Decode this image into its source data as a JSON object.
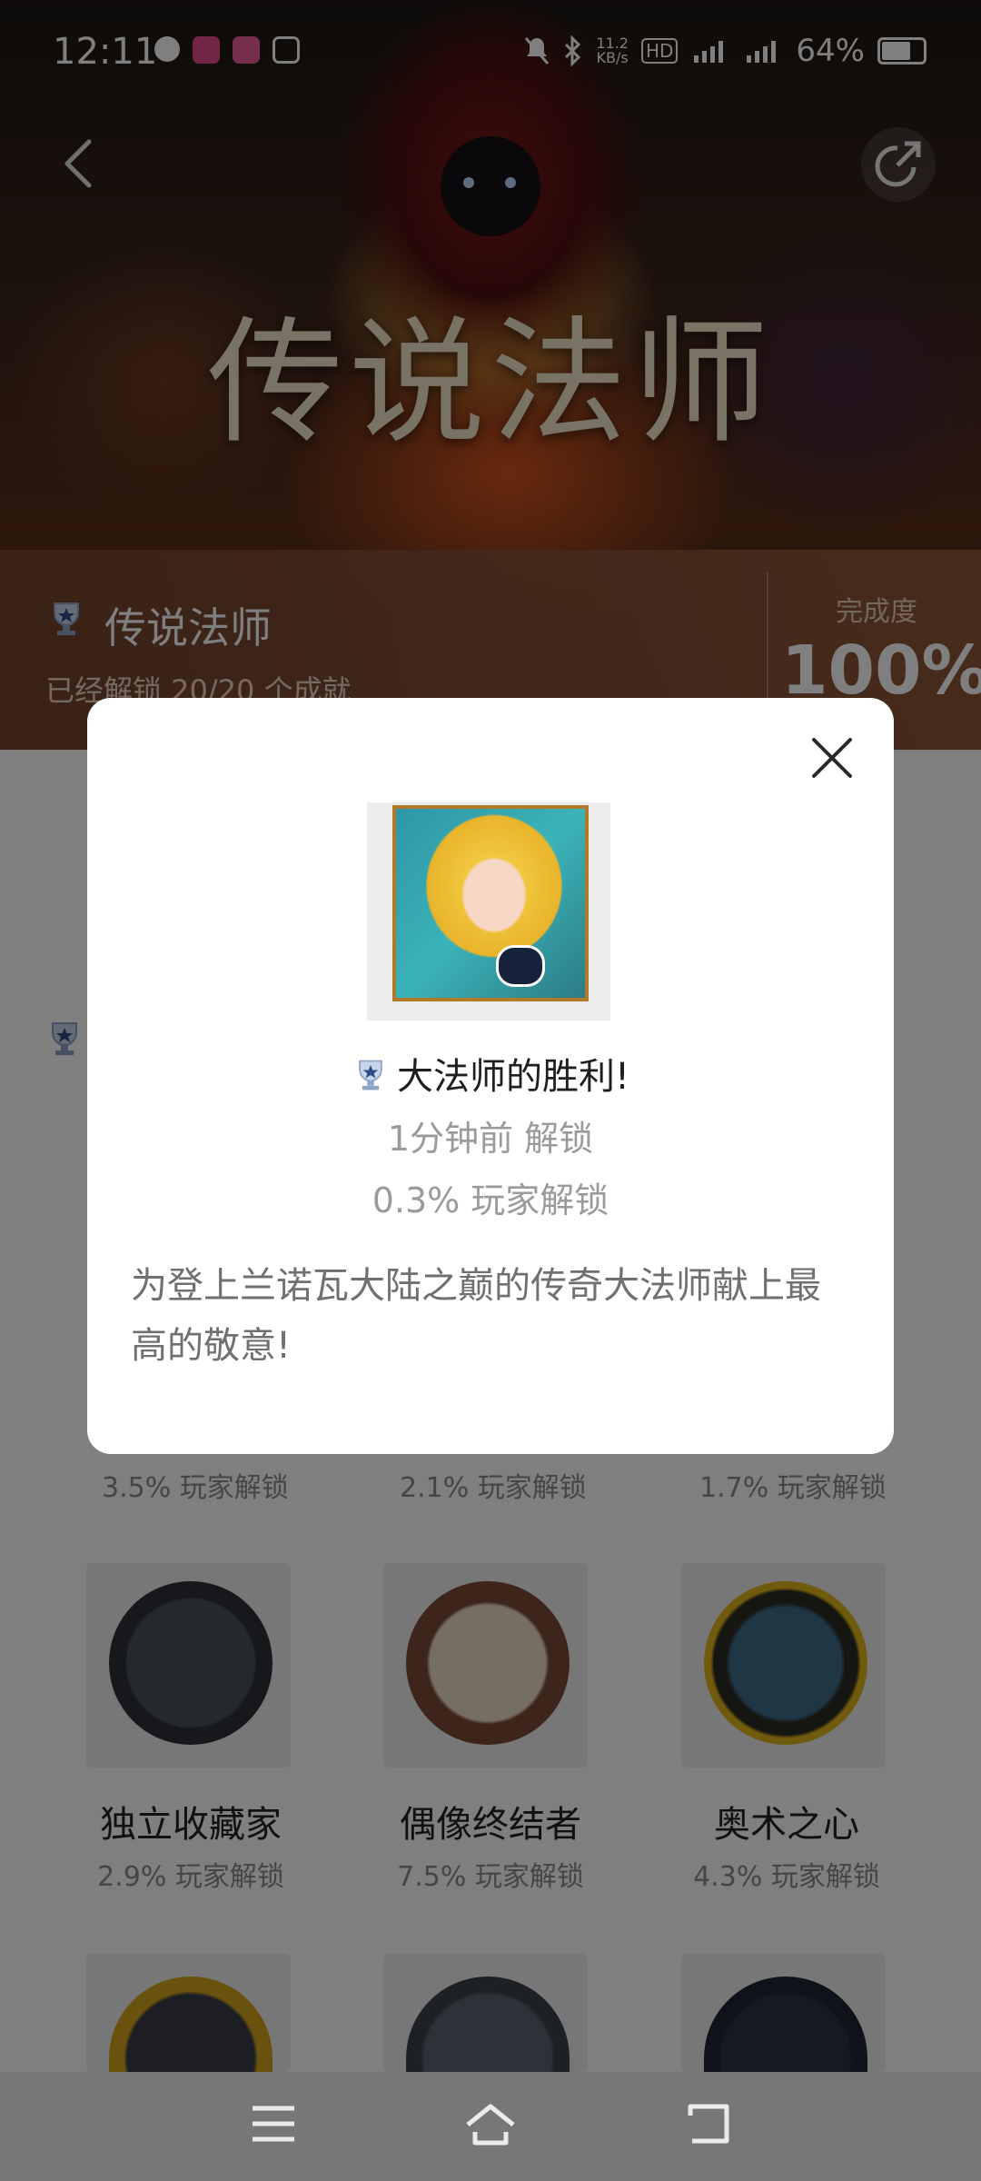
{
  "status_bar": {
    "time": "12:11",
    "speed": "11.2",
    "speed_unit": "KB/s",
    "battery": "64%"
  },
  "hero": {
    "title": "传说法师"
  },
  "info": {
    "title": "传说法师",
    "subtitle": "已经解锁 20/20 个成就",
    "progress_label": "完成度",
    "progress_value": "100%"
  },
  "list": {
    "row1_pcts": [
      "3.5% 玩家解锁",
      "2.1% 玩家解锁",
      "1.7% 玩家解锁"
    ],
    "row2": [
      {
        "name": "独立收藏家",
        "pct": "2.9% 玩家解锁",
        "icon": "potions-icon"
      },
      {
        "name": "偶像终结者",
        "pct": "7.5% 玩家解锁",
        "icon": "easel-icon"
      },
      {
        "name": "奥术之心",
        "pct": "4.3% 玩家解锁",
        "icon": "spellbook-icon"
      }
    ]
  },
  "modal": {
    "title": "大法师的胜利!",
    "unlock_time": "1分钟前 解锁",
    "unlock_rate": "0.3% 玩家解锁",
    "description": "为登上兰诺瓦大陆之巅的传奇大法师献上最高的敬意!"
  },
  "colors": {
    "accent_border": "#b07a2a",
    "overlay": "rgba(0,0,0,0.5)"
  }
}
